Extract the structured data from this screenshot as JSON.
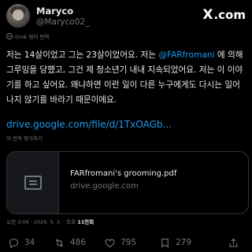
{
  "user": {
    "name": "Maryco",
    "handle": "@Maryco02_"
  },
  "brand": {
    "logo_text": ".com",
    "logo_mark": "X"
  },
  "translation_note": "Grok 영어 번역",
  "post": {
    "lines": [
      {
        "pre": "저는 14살이었고 그는 23살이었어요. 저는 ",
        "mention": "@FARfromani",
        "post": " 에 의해"
      },
      {
        "pre": "그루밍을 당했고, 그건 제 청소년기 내내 지속되었어요. 저는 이 이야",
        "mention": "",
        "post": ""
      },
      {
        "pre": "기를 하고 싶어요. 왜냐하면 이런 일이 다른 누구에게도 다시는 일어",
        "mention": "",
        "post": ""
      },
      {
        "pre": "나지 않기를 바라기 때문이에요.",
        "mention": "",
        "post": ""
      }
    ],
    "link": "drive.google.com/file/d/1TxOAGb..."
  },
  "rate_translation": "이 번역 평가하기",
  "card": {
    "title": "FARfromani's grooming.pdf",
    "domain": "drive.google.com"
  },
  "meta": {
    "time": "오전 3:06 · 2026. 5. 3. · 조회 ",
    "views": "11만회"
  },
  "actions": {
    "reply_count": "34",
    "retweet_count": "486",
    "like_count": "795",
    "bookmark_count": "279"
  },
  "colors": {
    "background": "#000000",
    "text": "#e7e9ea",
    "muted": "#71767b",
    "accent": "#1d9bf0",
    "border": "#2f3336"
  },
  "icons": [
    "reply-icon",
    "retweet-icon",
    "like-icon",
    "bookmark-icon",
    "share-icon",
    "document-icon",
    "grok-icon"
  ]
}
